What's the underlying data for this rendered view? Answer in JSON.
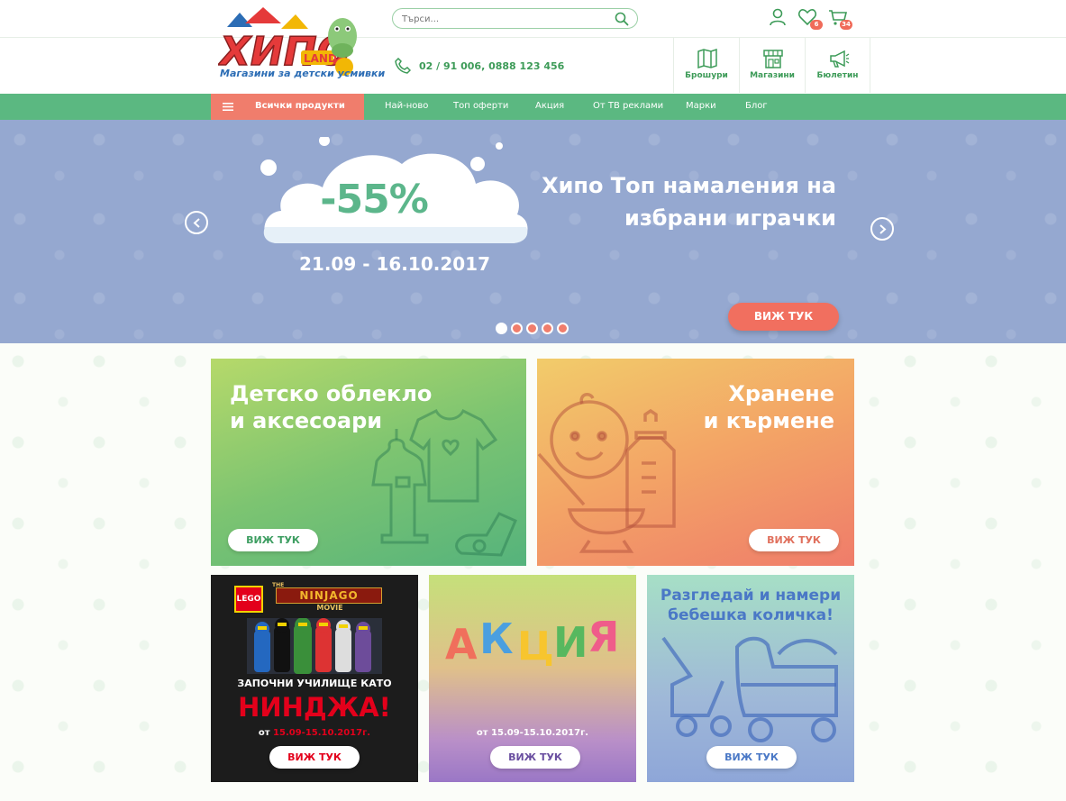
{
  "header": {
    "logo_text": "ХИПО",
    "logo_sub": "LAND",
    "tagline": "Магазини за детски усмивки",
    "search_placeholder": "Търси...",
    "phone": "02 / 91 006,  0888 123 456",
    "wishlist_count": "6",
    "cart_count": "34",
    "quick_links": [
      {
        "label": "Брошури",
        "icon": "map-icon"
      },
      {
        "label": "Магазини",
        "icon": "store-icon"
      },
      {
        "label": "Бюлетин",
        "icon": "megaphone-icon"
      }
    ]
  },
  "nav": {
    "all_products": "Всички продукти",
    "items": [
      "Най-ново",
      "Топ оферти",
      "Акция",
      "От ТВ реклами",
      "Марки",
      "Блог"
    ]
  },
  "hero": {
    "discount": "-55%",
    "dates": "21.09 - 16.10.2017",
    "title_line1": "Хипо Топ намаления на",
    "title_line2": "избрани играчки",
    "cta": "ВИЖ ТУК",
    "slides": 5,
    "active_slide": 1
  },
  "tiles": {
    "clothing": {
      "line1": "Детско облекло",
      "line2": "и аксесоари",
      "cta": "ВИЖ ТУК"
    },
    "feeding": {
      "line1": "Хранене",
      "line2": "и кърмене",
      "cta": "ВИЖ ТУК"
    },
    "lego": {
      "brand": "LEGO",
      "movie_the": "THE",
      "movie_name": "NINJAGO",
      "movie_word": "MOVIE",
      "headline": "ЗАПОЧНИ УЧИЛИЩЕ КАТО",
      "headline_big": "НИНДЖА!",
      "dates_prefix": "от ",
      "dates": "15.09-15.10.2017г.",
      "cta": "ВИЖ ТУК"
    },
    "promo": {
      "letters": [
        "А",
        "К",
        "Ц",
        "И",
        "Я"
      ],
      "dates": "от 15.09-15.10.2017г.",
      "cta": "ВИЖ ТУК"
    },
    "stroller": {
      "line1": "Разгледай и намери",
      "line2": "бебешка количка!",
      "cta": "ВИЖ ТУК"
    }
  },
  "colors": {
    "brand_green": "#5bb881",
    "accent_coral": "#f07d6c",
    "hero_blue": "#95a8d0"
  }
}
